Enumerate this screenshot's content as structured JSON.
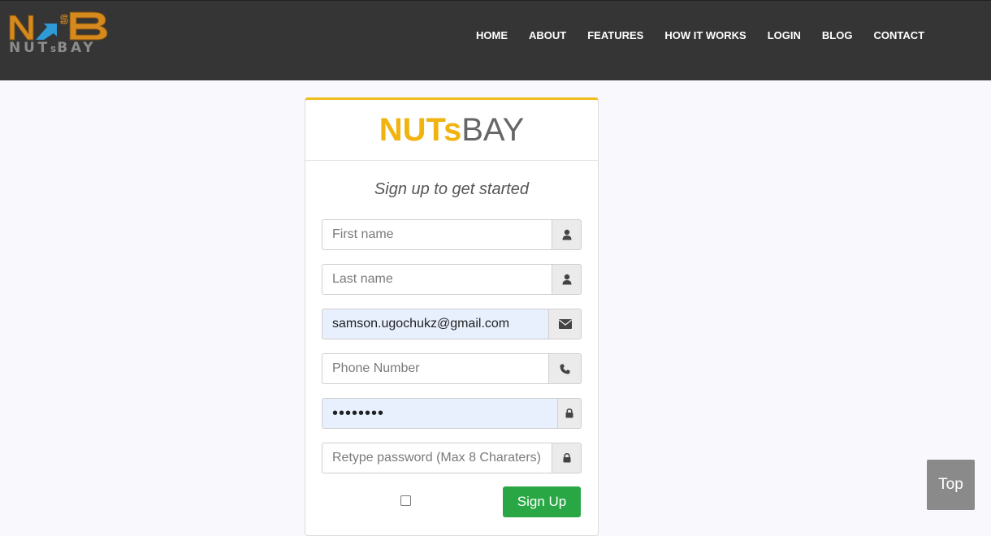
{
  "brand": {
    "logo_mark": "NSB",
    "logo_text_pre": "NUT",
    "logo_text_small": "s",
    "logo_text_post": "BAY"
  },
  "nav": {
    "items": [
      "HOME",
      "ABOUT",
      "FEATURES",
      "HOW IT WORKS",
      "LOGIN",
      "BLOG",
      "CONTACT"
    ]
  },
  "card": {
    "title_bold": "NUTs",
    "title_light": "BAY",
    "subtitle": "Sign up to get started"
  },
  "form": {
    "first_name": {
      "placeholder": "First name",
      "value": "",
      "icon": "user-icon"
    },
    "last_name": {
      "placeholder": "Last name",
      "value": "",
      "icon": "user-icon"
    },
    "email": {
      "placeholder": "",
      "value": "samson.ugochukz@gmail.com",
      "icon": "envelope-icon"
    },
    "phone": {
      "placeholder": "Phone Number",
      "value": "",
      "icon": "phone-icon"
    },
    "password": {
      "placeholder": "",
      "value": "••••••••",
      "icon": "lock-icon"
    },
    "retype_password": {
      "placeholder": "Retype password (Max 8 Charaters)",
      "value": "",
      "icon": "lock-icon"
    },
    "agree_checked": false,
    "submit_label": "Sign Up"
  },
  "scroll_top_label": "Top",
  "colors": {
    "header_bg": "#353535",
    "accent_yellow": "#f0b30f",
    "logo_blue": "#2e9ad6",
    "submit_green": "#2aa745",
    "autofill_bg": "#e8f0fe"
  }
}
